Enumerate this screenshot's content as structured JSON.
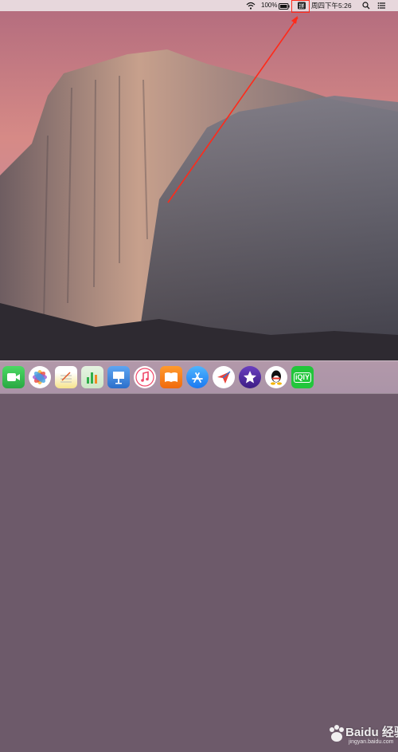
{
  "menubar": {
    "battery_percent": "100%",
    "clock": "周四下午5:26"
  },
  "icons": {
    "wifi": "wifi-icon",
    "battery": "battery-icon",
    "input_method": "input-method-icon",
    "search": "spotlight-search-icon",
    "notifications": "notification-center-icon"
  },
  "annotation": {
    "color": "#ff2a1a"
  },
  "dock": {
    "items": [
      "FaceTime",
      "Photos",
      "Notes",
      "Numbers",
      "Keynote",
      "Music",
      "Books",
      "App Store",
      "Plane",
      "iMovie",
      "QQ",
      "iQIYI"
    ],
    "iqiyi_label": "iQIY"
  },
  "watermark": {
    "text": "Baidu 经验",
    "sub": "jingyan.baidu.com"
  }
}
